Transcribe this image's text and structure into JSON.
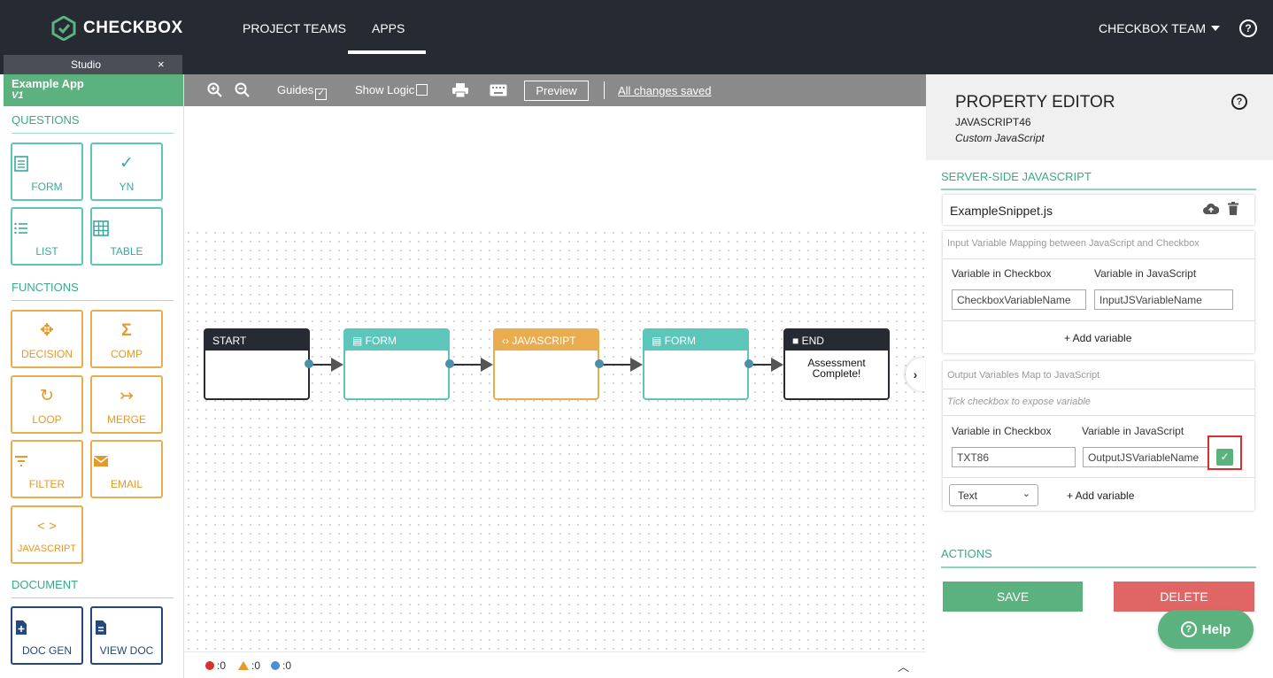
{
  "topnav": {
    "brand": "CHECKBOX",
    "links": [
      "PROJECT TEAMS",
      "APPS"
    ],
    "team": "CHECKBOX TEAM",
    "help": "?"
  },
  "studio": {
    "tab_label": "Studio",
    "close": "×"
  },
  "app": {
    "name": "Example App",
    "version": "V1"
  },
  "sidebar": {
    "questions_title": "QUESTIONS",
    "questions": [
      {
        "label": "FORM",
        "icon": "form-icon"
      },
      {
        "label": "YN",
        "icon": "check-icon"
      },
      {
        "label": "LIST",
        "icon": "list-icon"
      },
      {
        "label": "TABLE",
        "icon": "table-icon"
      }
    ],
    "functions_title": "FUNCTIONS",
    "functions": [
      {
        "label": "DECISION",
        "icon": "decision-icon"
      },
      {
        "label": "COMP",
        "icon": "sigma-icon"
      },
      {
        "label": "LOOP",
        "icon": "loop-icon"
      },
      {
        "label": "MERGE",
        "icon": "merge-icon"
      },
      {
        "label": "FILTER",
        "icon": "filter-icon"
      },
      {
        "label": "EMAIL",
        "icon": "email-icon"
      },
      {
        "label": "JAVASCRIPT",
        "icon": "code-icon"
      }
    ],
    "document_title": "DOCUMENT",
    "document": [
      {
        "label": "DOC GEN",
        "icon": "doc-gen-icon"
      },
      {
        "label": "VIEW DOC",
        "icon": "view-doc-icon"
      }
    ]
  },
  "toolbar": {
    "guides": "Guides",
    "show_logic": "Show Logic",
    "preview": "Preview",
    "saved": "All changes saved"
  },
  "flow": {
    "nodes": [
      {
        "type": "START",
        "body": ""
      },
      {
        "type": "FORM",
        "body": ""
      },
      {
        "type": "JAVASCRIPT",
        "body": ""
      },
      {
        "type": "FORM",
        "body": ""
      },
      {
        "type": "END",
        "body": "Assessment Complete!"
      }
    ]
  },
  "status": {
    "errors": ":0",
    "warnings": ":0",
    "info": ":0"
  },
  "property_editor": {
    "title": "PROPERTY EDITOR",
    "element_id": "JAVASCRIPT46",
    "element_type": "Custom JavaScript",
    "section_js": "SERVER-SIDE JAVASCRIPT",
    "snippet": "ExampleSnippet.js",
    "input_mapping_note": "Input Variable Mapping between JavaScript and Checkbox",
    "col_checkbox": "Variable in Checkbox",
    "col_js": "Variable in JavaScript",
    "input_checkbox_var": "CheckboxVariableName",
    "input_js_var": "InputJSVariableName",
    "add_variable": "+ Add variable",
    "output_note": "Output Variables Map to JavaScript",
    "output_hint": "Tick checkbox to expose variable",
    "output_checkbox_var": "TXT86",
    "output_js_var": "OutputJSVariableName",
    "type_select": "Text",
    "section_actions": "ACTIONS",
    "save": "SAVE",
    "delete": "DELETE"
  },
  "help_button": "Help",
  "colors": {
    "nav_bg": "#262b33",
    "green": "#5cb27e",
    "teal": "#5dc6ba",
    "orange": "#e9ad4f",
    "navy": "#24477c",
    "delete_red": "#e06565"
  }
}
